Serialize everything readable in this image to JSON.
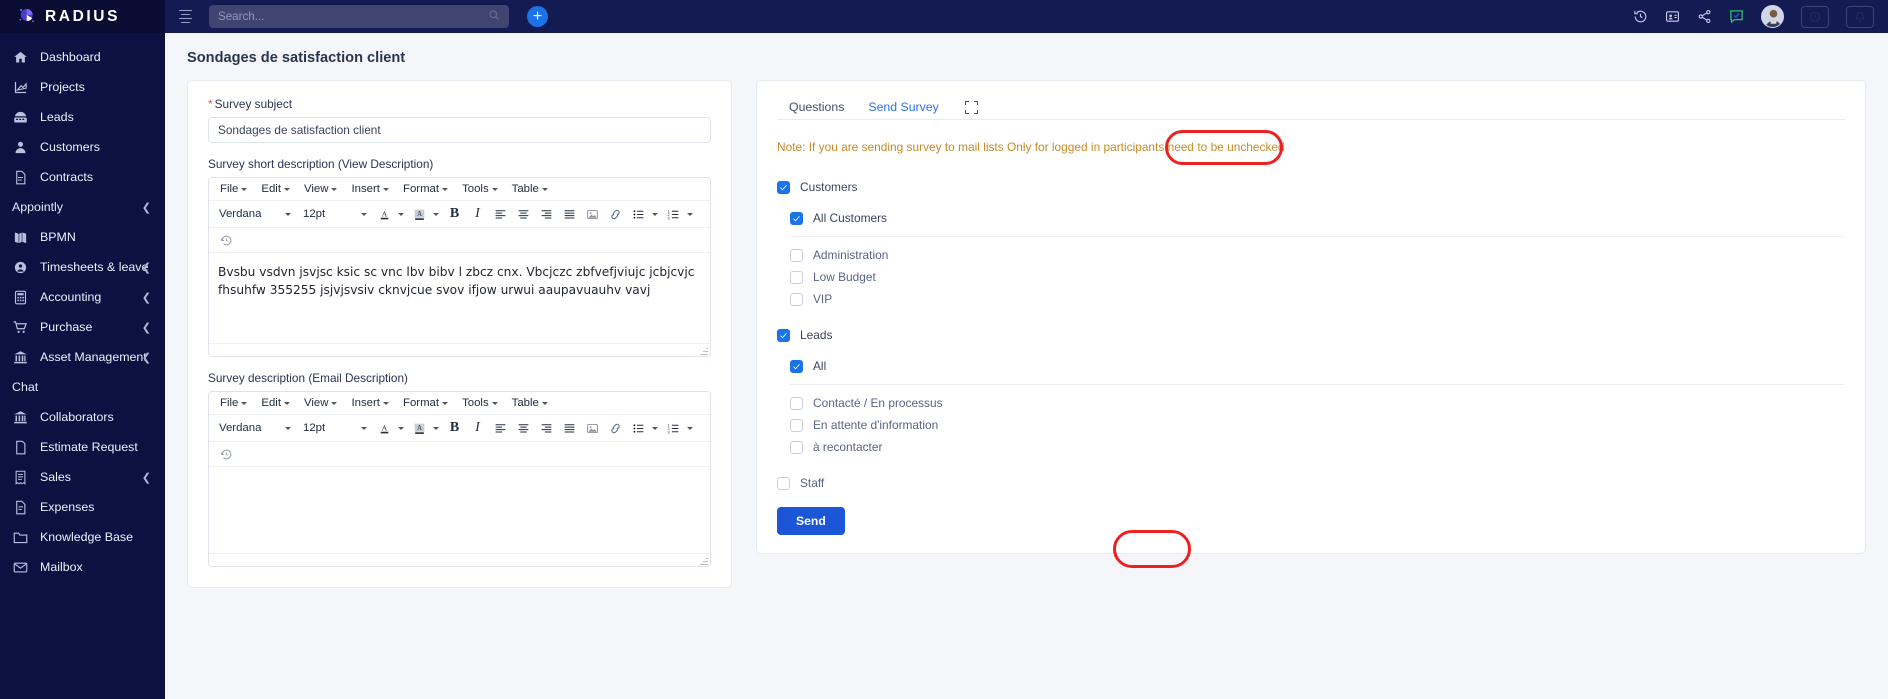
{
  "brand": {
    "name": "RADIUS",
    "logo_icon": "radius-logo-icon"
  },
  "topbar": {
    "menu_icon": "hamburger-icon",
    "search": {
      "placeholder": "Search...",
      "value": "",
      "icon": "search-icon"
    },
    "add_button_label": "+",
    "icons": [
      {
        "name": "history-icon",
        "label": "History"
      },
      {
        "name": "contact-card-icon",
        "label": "Contacts"
      },
      {
        "name": "share-icon",
        "label": "Share"
      },
      {
        "name": "chat-check-icon",
        "label": "Chat"
      }
    ],
    "avatar": "user-avatar",
    "ghost_buttons": [
      {
        "name": "clock-button",
        "label": ""
      },
      {
        "name": "notification-bell-button",
        "label": ""
      }
    ]
  },
  "sidebar": {
    "items": [
      {
        "label": "Dashboard",
        "icon": "home-icon",
        "type": "item",
        "chevron": false
      },
      {
        "label": "Projects",
        "icon": "chart-icon",
        "type": "item",
        "chevron": false
      },
      {
        "label": "Leads",
        "icon": "telephone-icon",
        "type": "item",
        "chevron": false
      },
      {
        "label": "Customers",
        "icon": "user-icon",
        "type": "item",
        "chevron": false
      },
      {
        "label": "Contracts",
        "icon": "document-icon",
        "type": "item",
        "chevron": false
      },
      {
        "label": "Appointly",
        "icon": "",
        "type": "section",
        "chevron": true
      },
      {
        "label": "BPMN",
        "icon": "book-icon",
        "type": "item",
        "chevron": false
      },
      {
        "label": "Timesheets & leave",
        "icon": "user-circle-icon",
        "type": "item",
        "chevron": true
      },
      {
        "label": "Accounting",
        "icon": "calculator-icon",
        "type": "item",
        "chevron": true
      },
      {
        "label": "Purchase",
        "icon": "cart-icon",
        "type": "item",
        "chevron": true
      },
      {
        "label": "Asset Management",
        "icon": "bank-icon",
        "type": "item",
        "chevron": true
      },
      {
        "label": "Chat",
        "icon": "",
        "type": "section",
        "chevron": false
      },
      {
        "label": "Collaborators",
        "icon": "bank-icon",
        "type": "item",
        "chevron": false
      },
      {
        "label": "Estimate Request",
        "icon": "file-icon",
        "type": "item",
        "chevron": false
      },
      {
        "label": "Sales",
        "icon": "receipt-icon",
        "type": "item",
        "chevron": true
      },
      {
        "label": "Expenses",
        "icon": "document-icon",
        "type": "item",
        "chevron": false
      },
      {
        "label": "Knowledge Base",
        "icon": "folder-icon",
        "type": "item",
        "chevron": false
      },
      {
        "label": "Mailbox",
        "icon": "envelope-icon",
        "type": "item",
        "chevron": false
      }
    ]
  },
  "page": {
    "title": "Sondages de satisfaction client"
  },
  "form": {
    "subject_label": "Survey subject",
    "subject_required_mark": "*",
    "subject_value": "Sondages de satisfaction client",
    "subject_placeholder": "",
    "short_description_label": "Survey short description (View Description)",
    "email_description_label": "Survey description (Email Description)",
    "editor_menu": [
      "File",
      "Edit",
      "View",
      "Insert",
      "Format",
      "Tools",
      "Table"
    ],
    "font_family": "Verdana",
    "font_size": "12pt",
    "short_description_body": "Bvsbu vsdvn jsvjsc ksic sc vnc lbv bibv l zbcz cnx. Vbcjczc zbfvefjviujc jcbjcvjc fhsuhfw 355255 jsjvjsvsiv  cknvjcue svov ifjow  urwui aaupavuauhv vavj",
    "email_description_body": ""
  },
  "editor_buttons": {
    "text_color": "text-color-icon",
    "highlight_color": "highlight-color-icon",
    "bold": "bold-icon",
    "italic": "italic-icon",
    "align_left": "align-left-icon",
    "align_center": "align-center-icon",
    "align_right": "align-right-icon",
    "align_justify": "align-justify-icon",
    "image": "image-icon",
    "link": "link-icon",
    "bullet_list": "bullet-list-icon",
    "numbered_list": "numbered-list-icon",
    "restore": "restore-draft-icon"
  },
  "right_panel": {
    "tabs": [
      {
        "label": "Questions",
        "active": false
      },
      {
        "label": "Send Survey",
        "active": true
      }
    ],
    "expand_icon": "expand-icon",
    "note": "Note: If you are sending survey to mail lists Only for logged in participants need to be unchecked",
    "groups": [
      {
        "name": "customers",
        "header": {
          "label": "Customers",
          "checked": true
        },
        "all": {
          "label": "All Customers",
          "checked": true
        },
        "options": [
          {
            "label": "Administration",
            "checked": false
          },
          {
            "label": "Low Budget",
            "checked": false
          },
          {
            "label": "VIP",
            "checked": false
          }
        ]
      },
      {
        "name": "leads",
        "header": {
          "label": "Leads",
          "checked": true
        },
        "all": {
          "label": "All",
          "checked": true
        },
        "options": [
          {
            "label": "Contacté / En processus",
            "checked": false
          },
          {
            "label": "En attente d'information",
            "checked": false
          },
          {
            "label": "à recontacter",
            "checked": false
          }
        ]
      }
    ],
    "staff": {
      "label": "Staff",
      "checked": false
    },
    "send_label": "Send"
  },
  "annotations": [
    {
      "name": "send-survey-highlight",
      "target": "Send Survey"
    },
    {
      "name": "send-button-highlight",
      "target": "Send"
    }
  ],
  "colors": {
    "sidebar_bg": "#0d1142",
    "topbar_bg": "#141a52",
    "accent_blue": "#1a73e8",
    "send_blue": "#1a56d6",
    "note_orange": "#c78a2a",
    "annotation_red": "#ef2020",
    "content_bg": "#f4f6fa"
  }
}
